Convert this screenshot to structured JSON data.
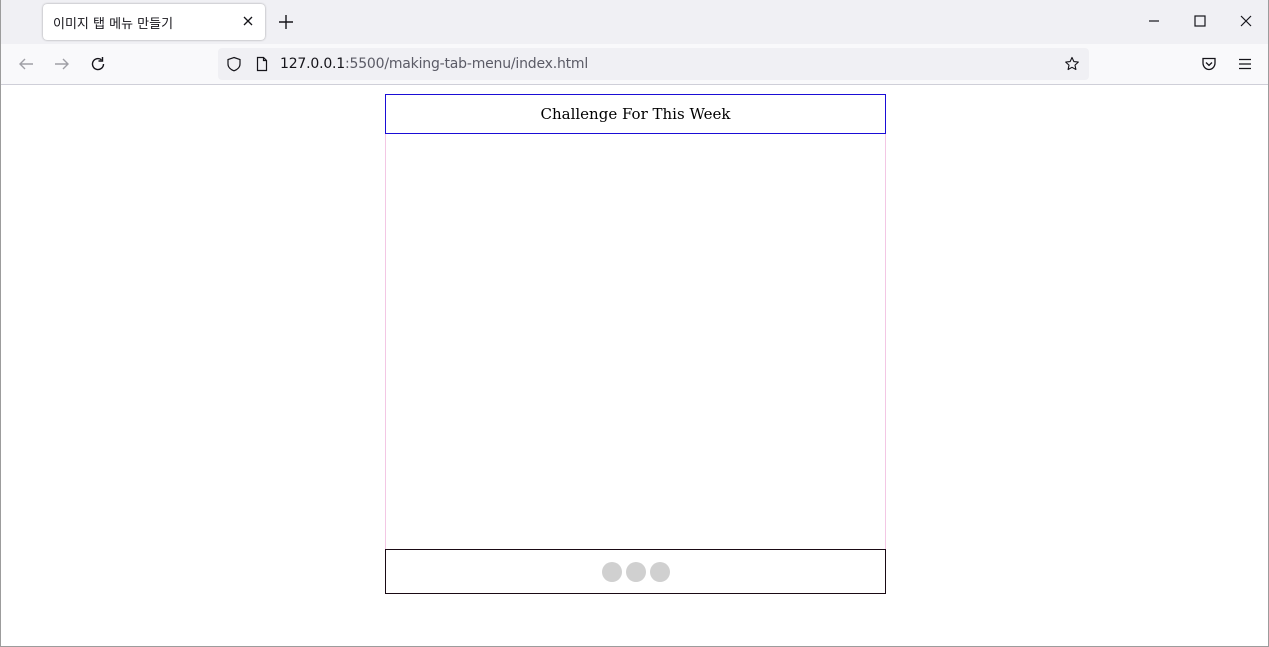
{
  "browser": {
    "tab": {
      "title": "이미지 탭 메뉴 만들기"
    },
    "address": {
      "host": "127.0.0.1",
      "rest": ":5500/making-tab-menu/index.html"
    },
    "icons": {
      "tab_close": "close-icon",
      "new_tab": "plus-icon",
      "minimize": "minimize-icon",
      "maximize": "maximize-icon",
      "close_window": "close-icon",
      "back": "back-arrow-icon",
      "forward": "forward-arrow-icon",
      "reload": "reload-icon",
      "shield": "shield-icon",
      "page": "page-icon",
      "bookmark": "star-icon",
      "pocket": "pocket-icon",
      "menu": "hamburger-menu-icon"
    }
  },
  "page": {
    "header_title": "Challenge For This Week",
    "colors": {
      "header_border": "#1a0dd6",
      "body_border": "#f3c7e4",
      "footer_border": "#1a0a14",
      "dot": "#d0d0d0"
    },
    "tab_dots": [
      {
        "label": ""
      },
      {
        "label": ""
      },
      {
        "label": ""
      }
    ]
  }
}
